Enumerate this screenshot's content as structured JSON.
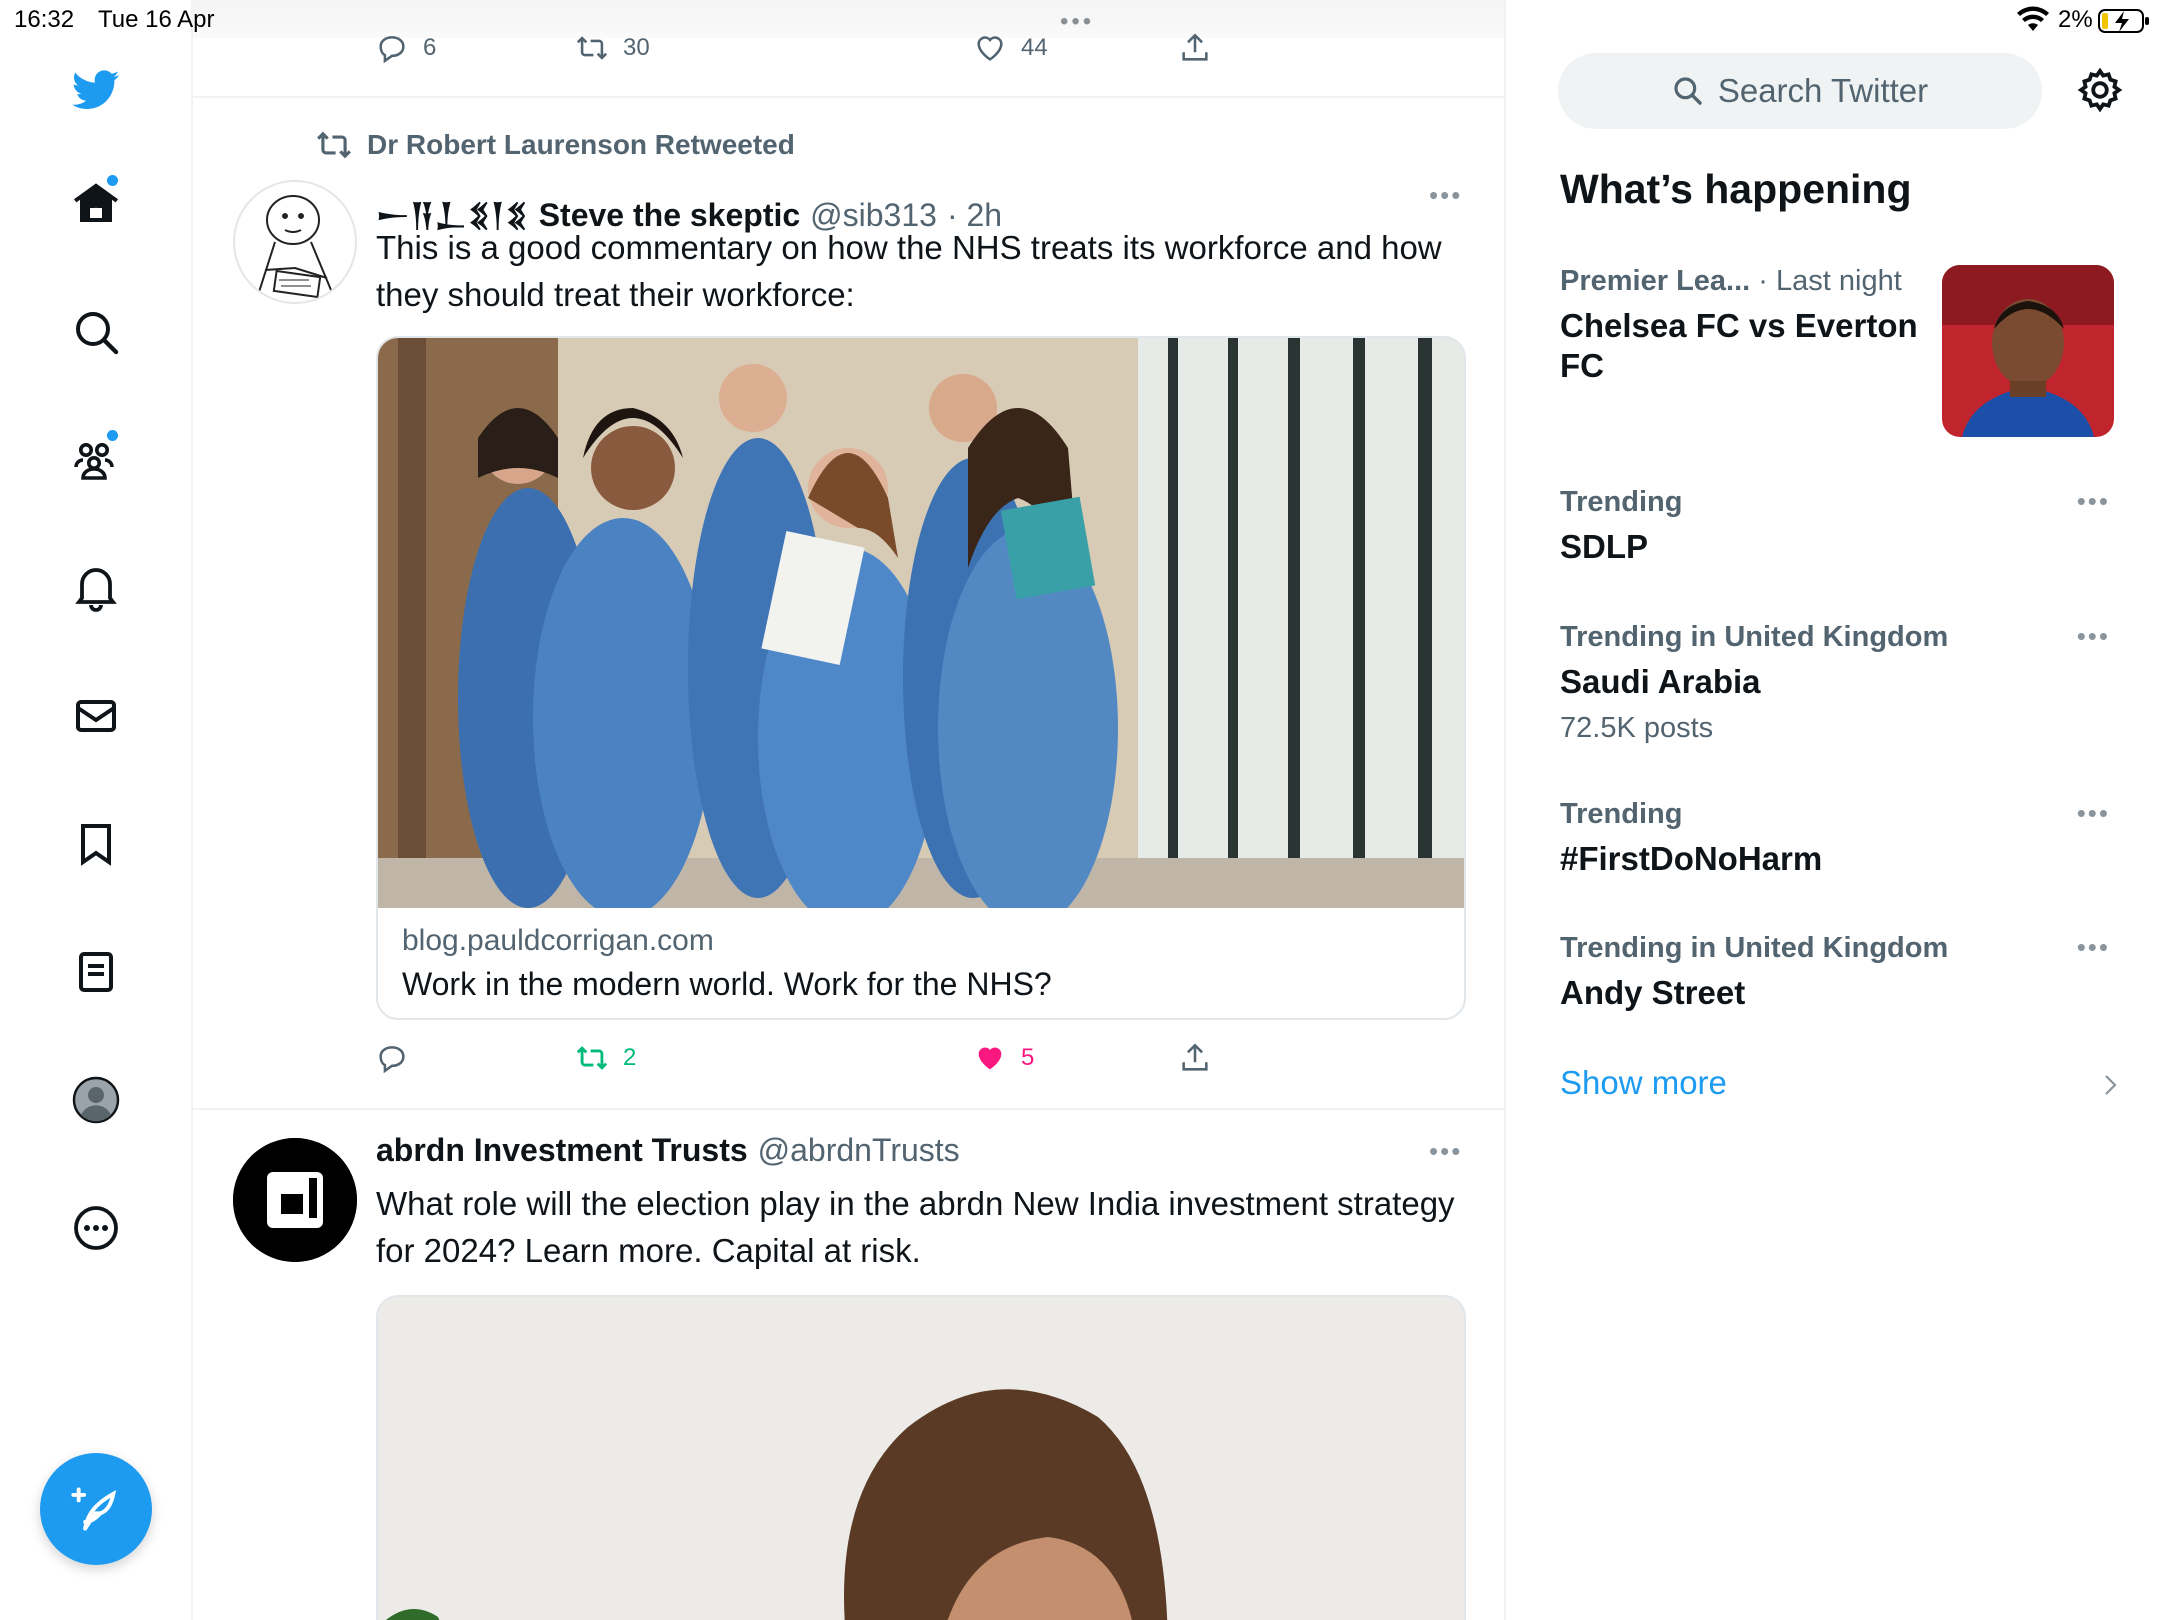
{
  "status_bar": {
    "time": "16:32",
    "date": "Tue 16 Apr",
    "battery": "2%"
  },
  "colors": {
    "accent": "#1d9bf0",
    "retweet_active": "#00ba7c",
    "like_active": "#f91880",
    "muted": "#536471"
  },
  "nav": {
    "items": [
      {
        "name": "twitter-logo-icon"
      },
      {
        "name": "home-icon",
        "has_dot": true
      },
      {
        "name": "search-icon"
      },
      {
        "name": "communities-icon",
        "has_dot": true
      },
      {
        "name": "notifications-icon"
      },
      {
        "name": "messages-icon"
      },
      {
        "name": "bookmarks-icon"
      },
      {
        "name": "lists-icon"
      },
      {
        "name": "profile-icon"
      },
      {
        "name": "more-icon"
      }
    ],
    "compose_icon": "compose-icon"
  },
  "timeline": {
    "prev_tweet_actions": {
      "replies": "6",
      "retweets": "30",
      "likes": "44"
    },
    "tweet1": {
      "retweeted_by": "Dr Robert Laurenson Retweeted",
      "name_glyphs": "𒀸𒀀𒁇𒐏𒁹𒐏",
      "name": "Steve the skeptic",
      "handle": "@sib313",
      "time": "· 2h",
      "text": "This is a good commentary on how the NHS treats its workforce and how they should treat their workforce:",
      "card_domain": "blog.pauldcorrigan.com",
      "card_title": "Work in the modern world. Work for the NHS?",
      "retweets": "2",
      "likes": "5"
    },
    "tweet2": {
      "name": "abrdn Investment Trusts",
      "handle": "@abrdnTrusts",
      "text": "What role will the election play in the abrdn New India investment strategy for 2024? Learn more. Capital at risk."
    }
  },
  "sidebar": {
    "search_placeholder": "Search Twitter",
    "title": "What’s happening",
    "featured": {
      "category": "Premier Lea...",
      "time": "· Last night",
      "title": "Chelsea FC vs Everton FC"
    },
    "trends": [
      {
        "context": "Trending",
        "name": "SDLP",
        "count": ""
      },
      {
        "context": "Trending in United Kingdom",
        "name": "Saudi Arabia",
        "count": "72.5K posts"
      },
      {
        "context": "Trending",
        "name": "#FirstDoNoHarm",
        "count": ""
      },
      {
        "context": "Trending in United Kingdom",
        "name": "Andy Street",
        "count": ""
      }
    ],
    "show_more": "Show more"
  }
}
